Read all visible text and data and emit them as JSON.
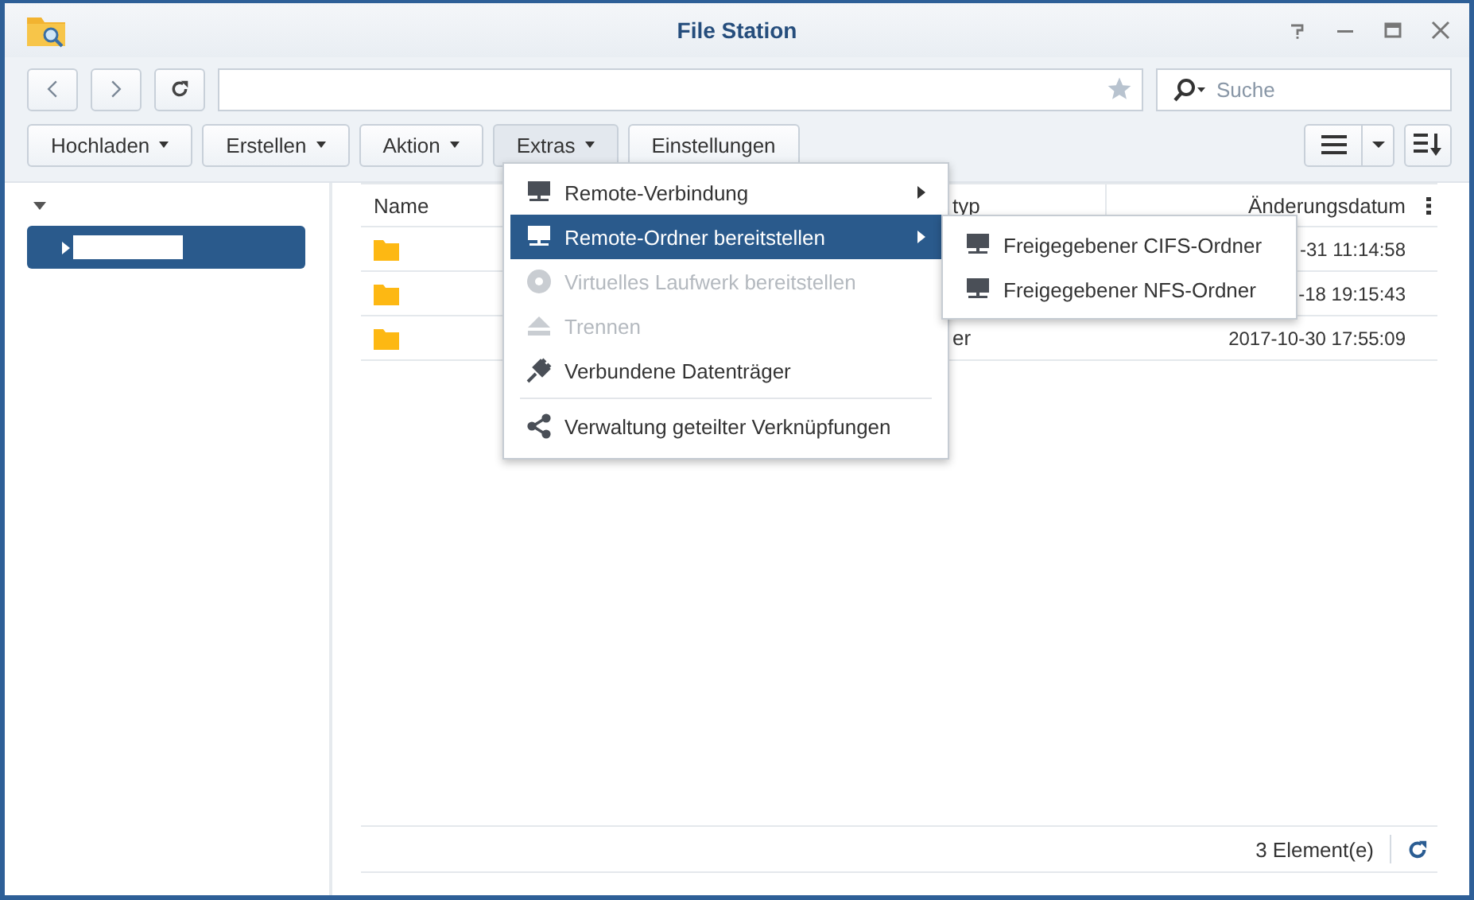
{
  "window": {
    "title": "File Station"
  },
  "search": {
    "placeholder": "Suche"
  },
  "toolbar": [
    {
      "label": "Hochladen",
      "dropdown": true,
      "selected": false
    },
    {
      "label": "Erstellen",
      "dropdown": true,
      "selected": false
    },
    {
      "label": "Aktion",
      "dropdown": true,
      "selected": false
    },
    {
      "label": "Extras",
      "dropdown": true,
      "selected": true
    },
    {
      "label": "Einstellungen",
      "dropdown": false,
      "selected": false
    }
  ],
  "sidebar": {
    "expanded": true,
    "items": [
      {
        "selected": true,
        "expanded": false
      }
    ]
  },
  "table": {
    "columns": [
      "Name",
      "typ",
      "Änderungsdatum"
    ],
    "rows": [
      {
        "kind": "folder",
        "modified": "-31 11:14:58"
      },
      {
        "kind": "folder",
        "modified": "-18 19:15:43"
      },
      {
        "kind": "folder",
        "type": "er",
        "modified": "2017-10-30 17:55:09"
      }
    ]
  },
  "menu": [
    {
      "label": "Remote-Verbindung",
      "kind": "network",
      "disabled": false,
      "selected": false,
      "submenu": true,
      "separator_before": false
    },
    {
      "label": "Remote-Ordner bereitstellen",
      "kind": "network",
      "disabled": false,
      "selected": true,
      "submenu": true,
      "separator_before": false
    },
    {
      "label": "Virtuelles Laufwerk bereitstellen",
      "kind": "disc",
      "disabled": true,
      "selected": false,
      "submenu": false,
      "separator_before": false
    },
    {
      "label": "Trennen",
      "kind": "eject",
      "disabled": true,
      "selected": false,
      "submenu": false,
      "separator_before": false
    },
    {
      "label": "Verbundene Datenträger",
      "kind": "plug",
      "disabled": false,
      "selected": false,
      "submenu": false,
      "separator_before": false
    },
    {
      "label": "Verwaltung geteilter Verknüpfungen",
      "kind": "share",
      "disabled": false,
      "selected": false,
      "submenu": false,
      "separator_before": true
    }
  ],
  "submenu": [
    {
      "label": "Freigegebener CIFS-Ordner"
    },
    {
      "label": "Freigegebener NFS-Ordner"
    }
  ],
  "status_bar": {
    "count": "3 Element(e)"
  }
}
